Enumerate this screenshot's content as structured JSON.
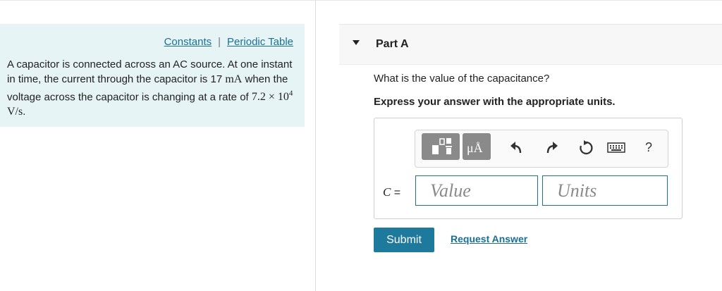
{
  "left": {
    "links": {
      "constants": "Constants",
      "separator": "|",
      "periodic_table": "Periodic Table"
    },
    "problem": {
      "t1": "A capacitor is connected across an AC source. At one instant in time, the current through the capacitor is 17 ",
      "unit_mA": "mA",
      "t2": " when the voltage across the capacitor is changing at a rate of ",
      "rate_mantissa": "7.2 × 10",
      "rate_exp": "4",
      "rate_unit": " V/s",
      "t3": "."
    }
  },
  "part": {
    "title": "Part A"
  },
  "question": "What is the value of the capacitance?",
  "instruction": "Express your answer with the appropriate units.",
  "toolbar": {
    "units_symbol": "μÅ",
    "help": "?"
  },
  "answer": {
    "variable": "C",
    "equals": " =",
    "value_placeholder": "Value",
    "units_placeholder": "Units"
  },
  "buttons": {
    "submit": "Submit",
    "request_answer": "Request Answer"
  }
}
